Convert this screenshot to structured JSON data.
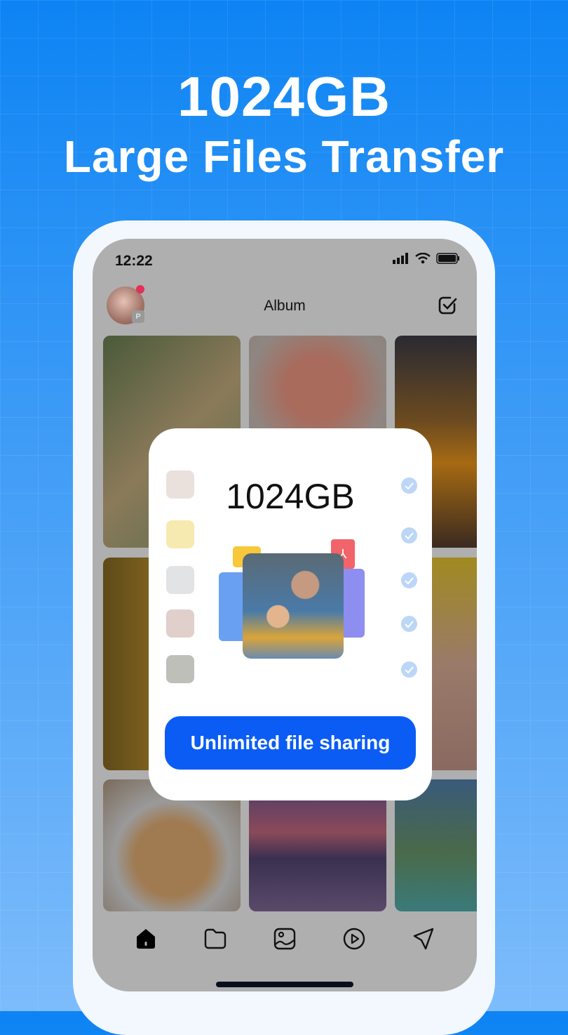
{
  "headline": {
    "line1": "1024GB",
    "line2": "Large Files Transfer"
  },
  "phone": {
    "status": {
      "time": "12:22",
      "icons": [
        "signal-icon",
        "wifi-icon",
        "battery-icon"
      ]
    },
    "header": {
      "title": "Album",
      "badge": "P",
      "notification_color": "#e23157"
    },
    "nav": [
      {
        "icon": "home-icon",
        "active": true
      },
      {
        "icon": "folder-icon"
      },
      {
        "icon": "image-icon"
      },
      {
        "icon": "play-icon"
      },
      {
        "icon": "send-icon"
      }
    ]
  },
  "modal": {
    "title": "1024GB",
    "button_label": "Unlimited file sharing",
    "accent": "#0a5cf5",
    "items": 5
  }
}
